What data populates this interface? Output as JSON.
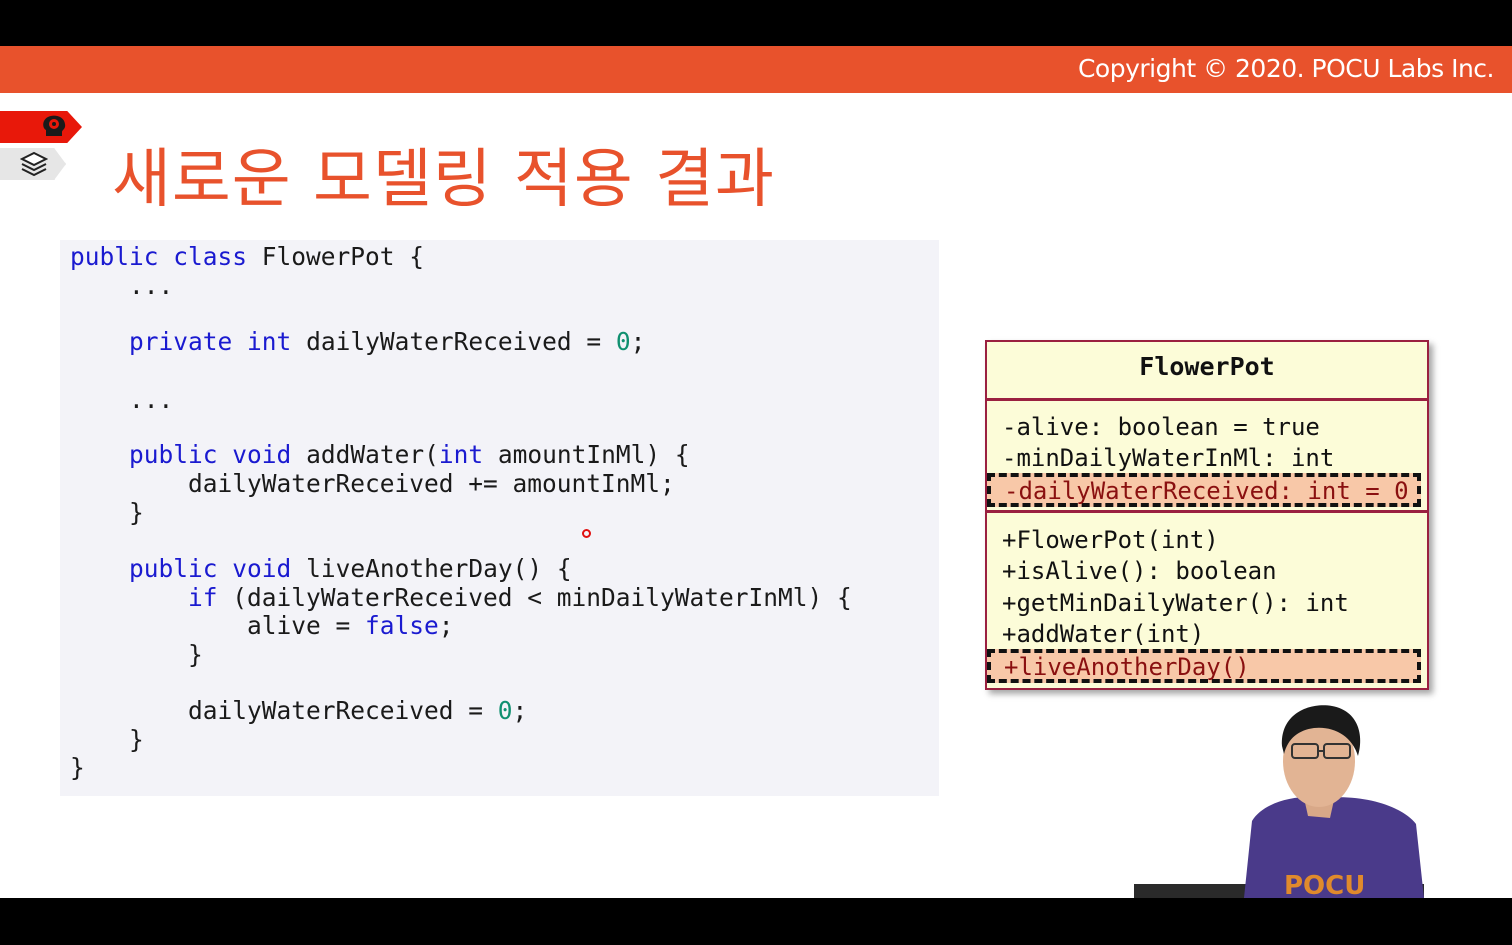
{
  "header": {
    "copyright": "Copyright © 2020. POCU Labs Inc.",
    "accent_color": "#e8522c"
  },
  "sidebar_icons": [
    "brain-icon",
    "layers-icon"
  ],
  "title": "새로운 모델링 적용 결과",
  "code": {
    "lines": [
      {
        "indent": "",
        "parts": [
          [
            "kw",
            "public"
          ],
          [
            "t",
            " "
          ],
          [
            "kw",
            "class"
          ],
          [
            "t",
            " FlowerPot {"
          ]
        ]
      },
      {
        "indent": "    ",
        "parts": [
          [
            "t",
            "..."
          ]
        ]
      },
      {
        "indent": "    ",
        "parts": [
          [
            "kw",
            "private"
          ],
          [
            "t",
            " "
          ],
          [
            "kw",
            "int"
          ],
          [
            "t",
            " dailyWaterReceived = "
          ],
          [
            "num",
            "0"
          ],
          [
            "t",
            ";"
          ]
        ]
      },
      {
        "indent": "    ",
        "parts": [
          [
            "t",
            "..."
          ]
        ]
      },
      {
        "indent": "    ",
        "parts": [
          [
            "kw",
            "public"
          ],
          [
            "t",
            " "
          ],
          [
            "kw",
            "void"
          ],
          [
            "t",
            " addWater("
          ],
          [
            "kw",
            "int"
          ],
          [
            "t",
            " amountInMl) {"
          ]
        ]
      },
      {
        "indent": "        ",
        "parts": [
          [
            "t",
            "dailyWaterReceived += amountInMl;"
          ]
        ]
      },
      {
        "indent": "    ",
        "parts": [
          [
            "t",
            "}"
          ]
        ]
      },
      {
        "indent": "    ",
        "parts": [
          [
            "kw",
            "public"
          ],
          [
            "t",
            " "
          ],
          [
            "kw",
            "void"
          ],
          [
            "t",
            " liveAnotherDay() {"
          ]
        ]
      },
      {
        "indent": "        ",
        "parts": [
          [
            "kw",
            "if"
          ],
          [
            "t",
            " (dailyWaterReceived < minDailyWaterInMl) {"
          ]
        ]
      },
      {
        "indent": "            ",
        "parts": [
          [
            "t",
            "alive = "
          ],
          [
            "kw",
            "false"
          ],
          [
            "t",
            ";"
          ]
        ]
      },
      {
        "indent": "        ",
        "parts": [
          [
            "t",
            "}"
          ]
        ]
      },
      {
        "indent": "        ",
        "parts": [
          [
            "t",
            "dailyWaterReceived = "
          ],
          [
            "num",
            "0"
          ],
          [
            "t",
            ";"
          ]
        ]
      },
      {
        "indent": "    ",
        "parts": [
          [
            "t",
            "}"
          ]
        ]
      },
      {
        "indent": "",
        "parts": [
          [
            "t",
            "}"
          ]
        ]
      }
    ]
  },
  "uml": {
    "class_name": "FlowerPot",
    "fields": [
      "-alive: boolean = true",
      "-minDailyWaterInMl: int"
    ],
    "highlighted_field": "-dailyWaterReceived: int = 0",
    "methods": [
      "+FlowerPot(int)",
      "+isAlive(): boolean",
      "+getMinDailyWater(): int",
      "+addWater(int)"
    ],
    "highlighted_method": "+liveAnotherDay()"
  },
  "presenter_shirt_text": "POCU"
}
